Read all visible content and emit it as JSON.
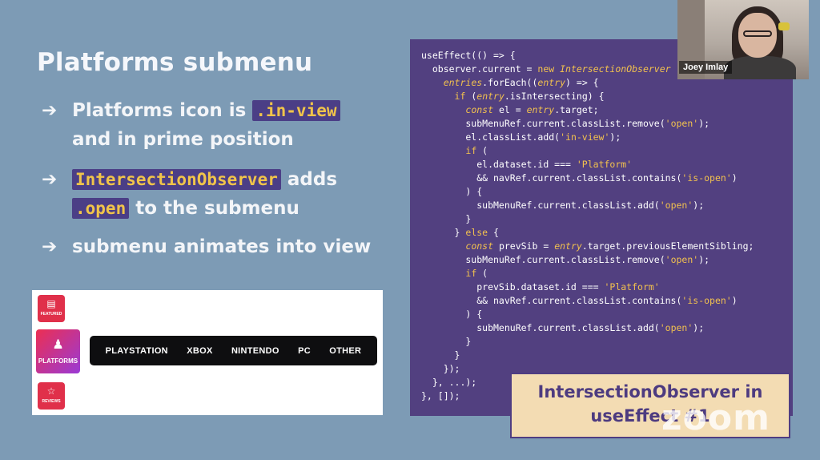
{
  "slide": {
    "title": "Platforms submenu",
    "bullets": [
      {
        "arrow": "➔",
        "pre": "Platforms icon is ",
        "code": ".in-view",
        "line2": "and in prime position"
      },
      {
        "arrow": "➔",
        "code1": "IntersectionObserver",
        "mid": " adds",
        "code2": ".open",
        "post": " to the submenu"
      },
      {
        "arrow": "➔",
        "text": "submenu animates into view"
      }
    ]
  },
  "demo": {
    "rail": [
      {
        "icon": "newspaper-icon",
        "glyph": "▤",
        "label": "FEATURED"
      },
      {
        "icon": "gamer-icon",
        "glyph": "♟",
        "label": "PLATFORMS"
      },
      {
        "icon": "star-icon",
        "glyph": "☆",
        "label": "REVIEWS"
      }
    ],
    "submenu": [
      "PLAYSTATION",
      "XBOX",
      "NINTENDO",
      "PC",
      "OTHER"
    ]
  },
  "code": [
    [
      [
        "",
        "useEffect(() => {"
      ]
    ],
    [
      [
        "",
        "  observer.current = "
      ],
      [
        "kw",
        "new"
      ],
      [
        "it",
        " IntersectionObserver"
      ]
    ],
    [
      [
        "",
        "    "
      ],
      [
        "it",
        "entries"
      ],
      [
        "",
        ".forEach(("
      ],
      [
        "it",
        "entry"
      ],
      [
        "",
        ") => {"
      ]
    ],
    [
      [
        "",
        "      "
      ],
      [
        "kw",
        "if"
      ],
      [
        "",
        " ("
      ],
      [
        "it",
        "entry"
      ],
      [
        "",
        ".isIntersecting) {"
      ]
    ],
    [
      [
        "",
        "        "
      ],
      [
        "it",
        "const"
      ],
      [
        "",
        " el = "
      ],
      [
        "it",
        "entry"
      ],
      [
        "",
        ".target;"
      ]
    ],
    [
      [
        "",
        "        subMenuRef.current.classList.remove("
      ],
      [
        "str",
        "'open'"
      ],
      [
        "",
        ");"
      ]
    ],
    [
      [
        "",
        "        el.classList.add("
      ],
      [
        "str",
        "'in-view'"
      ],
      [
        "",
        ");"
      ]
    ],
    [
      [
        "",
        "        "
      ],
      [
        "kw",
        "if"
      ],
      [
        "",
        " ("
      ]
    ],
    [
      [
        "",
        "          el.dataset.id === "
      ],
      [
        "str",
        "'Platform'"
      ]
    ],
    [
      [
        "",
        "          && navRef.current.classList.contains("
      ],
      [
        "str",
        "'is-open'"
      ],
      [
        "",
        ")"
      ]
    ],
    [
      [
        "",
        "        ) {"
      ]
    ],
    [
      [
        "",
        "          subMenuRef.current.classList.add("
      ],
      [
        "str",
        "'open'"
      ],
      [
        "",
        ");"
      ]
    ],
    [
      [
        "",
        "        }"
      ]
    ],
    [
      [
        "",
        "      } "
      ],
      [
        "kw",
        "else"
      ],
      [
        "",
        " {"
      ]
    ],
    [
      [
        "",
        "        "
      ],
      [
        "it",
        "const"
      ],
      [
        "",
        " prevSib = "
      ],
      [
        "it",
        "entry"
      ],
      [
        "",
        ".target.previousElementSibling;"
      ]
    ],
    [
      [
        "",
        "        subMenuRef.current.classList.remove("
      ],
      [
        "str",
        "'open'"
      ],
      [
        "",
        ");"
      ]
    ],
    [
      [
        "",
        "        "
      ],
      [
        "kw",
        "if"
      ],
      [
        "",
        " ("
      ]
    ],
    [
      [
        "",
        "          prevSib.dataset.id === "
      ],
      [
        "str",
        "'Platform'"
      ]
    ],
    [
      [
        "",
        "          && navRef.current.classList.contains("
      ],
      [
        "str",
        "'is-open'"
      ],
      [
        "",
        ")"
      ]
    ],
    [
      [
        "",
        "        ) {"
      ]
    ],
    [
      [
        "",
        "          subMenuRef.current.classList.add("
      ],
      [
        "str",
        "'open'"
      ],
      [
        "",
        ");"
      ]
    ],
    [
      [
        "",
        "        }"
      ]
    ],
    [
      [
        "",
        "      }"
      ]
    ],
    [
      [
        "",
        "    });"
      ]
    ],
    [
      [
        "",
        "  }, ...);"
      ]
    ],
    [
      [
        "",
        "}, []);"
      ]
    ]
  ],
  "webcam": {
    "name": "Joey Imlay"
  },
  "caption": {
    "line1": "IntersectionObserver in",
    "line2": "useEffect #1"
  },
  "watermark": "zoom",
  "colors": {
    "background": "#7d9bb5",
    "code_bg": "#524080",
    "highlight": "#f2c14e",
    "caption_bg": "#f3dcb3",
    "accent_red": "#e0304a"
  }
}
